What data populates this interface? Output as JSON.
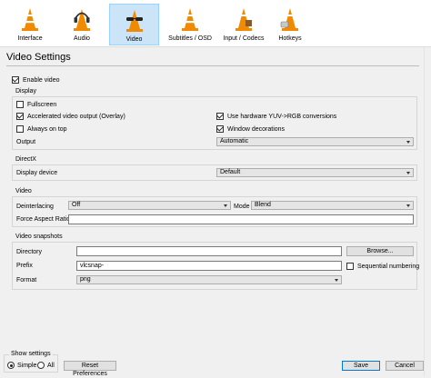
{
  "tabs": [
    {
      "label": "Interface",
      "icon": "vlc-cone-icon"
    },
    {
      "label": "Audio",
      "icon": "vlc-cone-headphones-icon"
    },
    {
      "label": "Video",
      "icon": "vlc-cone-glasses-icon"
    },
    {
      "label": "Subtitles / OSD",
      "icon": "vlc-cone-subtitles-icon"
    },
    {
      "label": "Input / Codecs",
      "icon": "vlc-cone-input-icon"
    },
    {
      "label": "Hotkeys",
      "icon": "vlc-cone-hotkeys-icon"
    }
  ],
  "title": "Video Settings",
  "enable_video": {
    "label": "Enable video",
    "checked": true
  },
  "display": {
    "title": "Display",
    "fullscreen": {
      "label": "Fullscreen",
      "checked": false
    },
    "accelerated": {
      "label": "Accelerated video output (Overlay)",
      "checked": true
    },
    "always_on_top": {
      "label": "Always on top",
      "checked": false
    },
    "hw_yuv": {
      "label": "Use hardware YUV->RGB conversions",
      "checked": true
    },
    "window_decorations": {
      "label": "Window decorations",
      "checked": true
    },
    "output_label": "Output",
    "output_value": "Automatic"
  },
  "directx": {
    "title": "DirectX",
    "device_label": "Display device",
    "device_value": "Default"
  },
  "video": {
    "title": "Video",
    "deinterlacing_label": "Deinterlacing",
    "deinterlacing_value": "Off",
    "mode_label": "Mode",
    "mode_value": "Blend",
    "aspect_label": "Force Aspect Ratio",
    "aspect_value": ""
  },
  "snapshots": {
    "title": "Video snapshots",
    "directory_label": "Directory",
    "directory_value": "",
    "browse_label": "Browse...",
    "prefix_label": "Prefix",
    "prefix_value": "vlcsnap-",
    "sequential_label": "Sequential numbering",
    "format_label": "Format",
    "format_value": "png"
  },
  "footer": {
    "show_settings_label": "Show settings",
    "simple_label": "Simple",
    "all_label": "All",
    "reset_label": "Reset Preferences",
    "save_label": "Save",
    "cancel_label": "Cancel"
  },
  "colors": {
    "accent": "#0078d7",
    "tab_selected": "#cce4f7",
    "cone_orange": "#f08a00"
  }
}
